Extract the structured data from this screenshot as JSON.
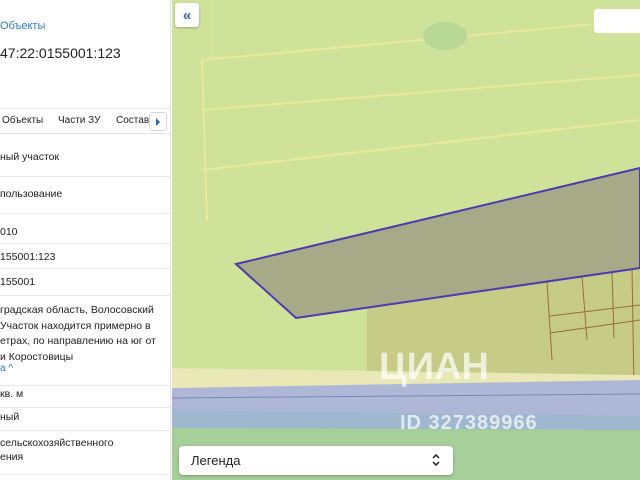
{
  "panel": {
    "breadcrumb": "Объекты",
    "cadastral_number": "47:22:0155001:123",
    "tabs": [
      "Объекты",
      "Части ЗУ",
      "Состав"
    ],
    "rows": [
      {
        "lines": [
          "ный участок"
        ]
      },
      {
        "lines": [
          "пользование"
        ]
      },
      {
        "lines": [
          "010"
        ]
      },
      {
        "lines": [
          "155001:123"
        ]
      },
      {
        "lines": [
          "155001"
        ]
      },
      {
        "lines": [
          "градская область, Волосовский",
          "Участок находится примерно в",
          "етрах, по направлению на юг от",
          "и Коростовицы"
        ]
      },
      {
        "lines": [
          "кв. м"
        ]
      },
      {
        "lines": [
          "ный"
        ]
      },
      {
        "lines": [
          "сельскохозяйственного",
          "ения"
        ]
      }
    ],
    "more_label": "а ^"
  },
  "map": {
    "collapse_icon": "«",
    "legend_label": "Легенда",
    "watermark_logo": "ЦИАН",
    "watermark_id": "ID 327389966"
  },
  "colors": {
    "map_green": "#cfe29a",
    "parcel_fill": "#a7aa86",
    "parcel_border": "#4b3bb0",
    "road_blue": "#aeb8d6",
    "link_blue": "#2b7bd6"
  }
}
